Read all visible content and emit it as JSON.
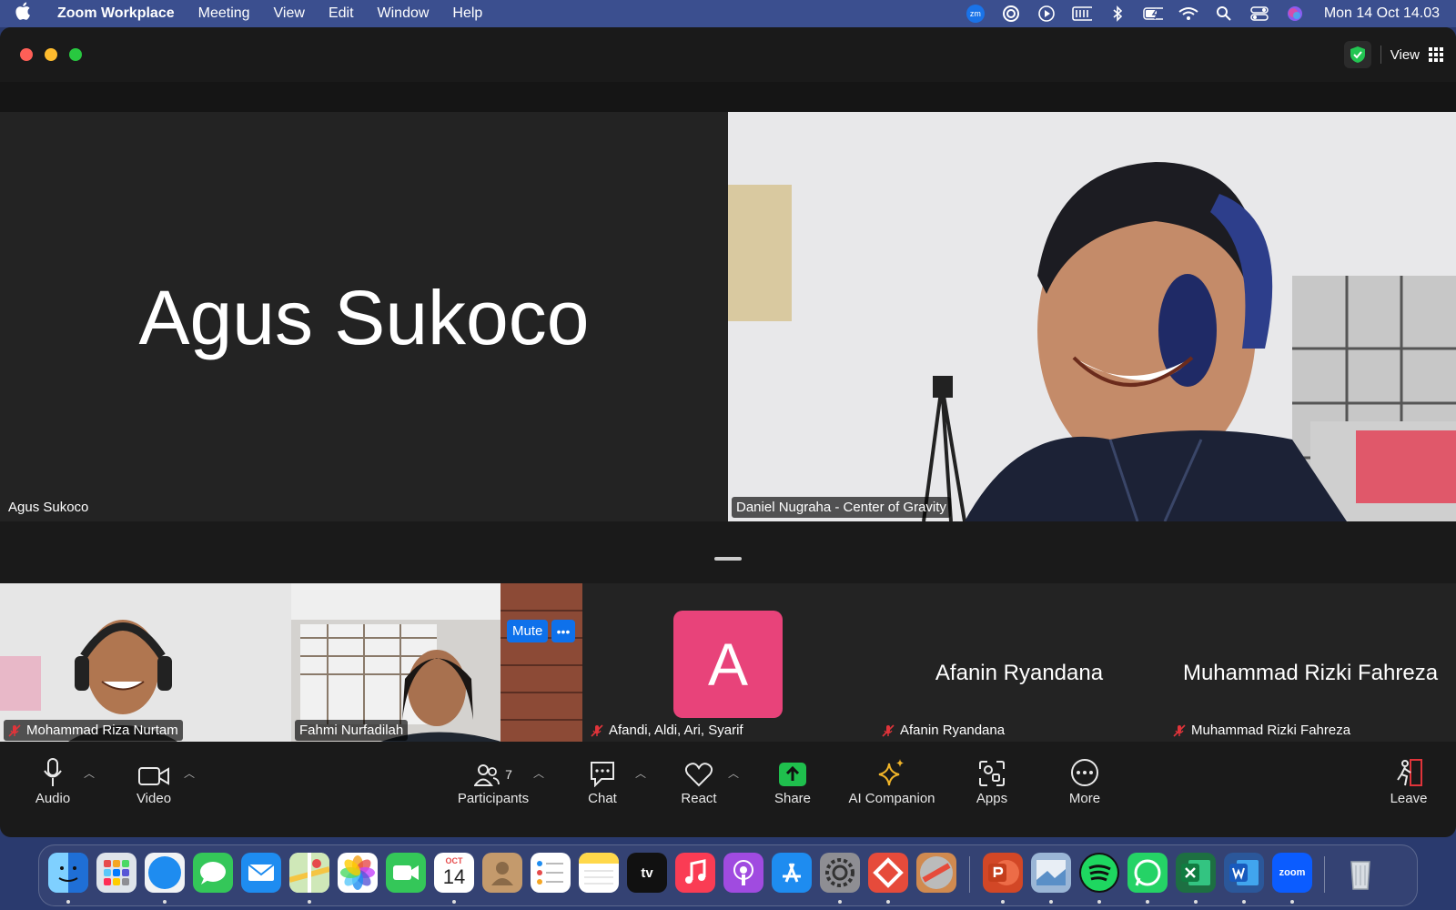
{
  "menubar": {
    "app_name": "Zoom Workplace",
    "items": [
      "Meeting",
      "View",
      "Edit",
      "Window",
      "Help"
    ],
    "status_icons": [
      "zoom-status-icon",
      "screen-record-icon",
      "play-icon",
      "battery-bar-icon",
      "bluetooth-icon",
      "battery-icon",
      "wifi-icon",
      "search-icon",
      "control-center-icon",
      "siri-icon"
    ],
    "zoom_badge": "zm",
    "clock": "Mon 14 Oct  14.03"
  },
  "window": {
    "view_label": "View"
  },
  "stage": {
    "speaker_left": {
      "big_name": "Agus Sukoco",
      "tag": "Agus Sukoco"
    },
    "speaker_right": {
      "tag": "Daniel Nugraha - Center of Gravity"
    }
  },
  "strip": {
    "tiles": [
      {
        "tag": "Mohammad Riza Nurtam",
        "muted": true
      },
      {
        "tag": "Fahmi Nurfadilah",
        "muted": false
      },
      {
        "tag": "Afandi, Aldi, Ari, Syarif",
        "avatar_letter": "A",
        "muted": true
      },
      {
        "tag": "Afanin Ryandana",
        "center_name": "Afanin Ryandana",
        "muted": true
      },
      {
        "tag": "Muhammad Rizki Fahreza",
        "center_name": "Muhammad Rizki Fahreza",
        "muted": true
      }
    ],
    "mute_button": "Mute",
    "more_button": "•••"
  },
  "toolbar": {
    "audio": "Audio",
    "video": "Video",
    "participants": "Participants",
    "participants_count": "7",
    "chat": "Chat",
    "react": "React",
    "share": "Share",
    "ai_companion": "AI Companion",
    "apps": "Apps",
    "more": "More",
    "leave": "Leave"
  },
  "dock": {
    "calendar_month": "OCT",
    "calendar_day": "14",
    "tv_label": "tv",
    "zoom_label": "zoom",
    "apps": [
      "finder",
      "launchpad",
      "safari",
      "messages",
      "mail",
      "maps",
      "photos",
      "facetime",
      "calendar",
      "contacts",
      "reminders",
      "notes",
      "apple-tv",
      "music",
      "podcasts",
      "app-store",
      "system-settings",
      "anydesk",
      "proxyman",
      "powerpoint",
      "preview",
      "spotify",
      "whatsapp",
      "excel",
      "word",
      "zoom",
      "trash"
    ]
  },
  "colors": {
    "menubar_bg": "#3b4f8f",
    "window_bg": "#1a1a1a",
    "avatar_bg": "#e8437a",
    "share_green": "#1fbf4d",
    "mute_blue": "#0e71eb",
    "muted_red": "#e0343a"
  }
}
